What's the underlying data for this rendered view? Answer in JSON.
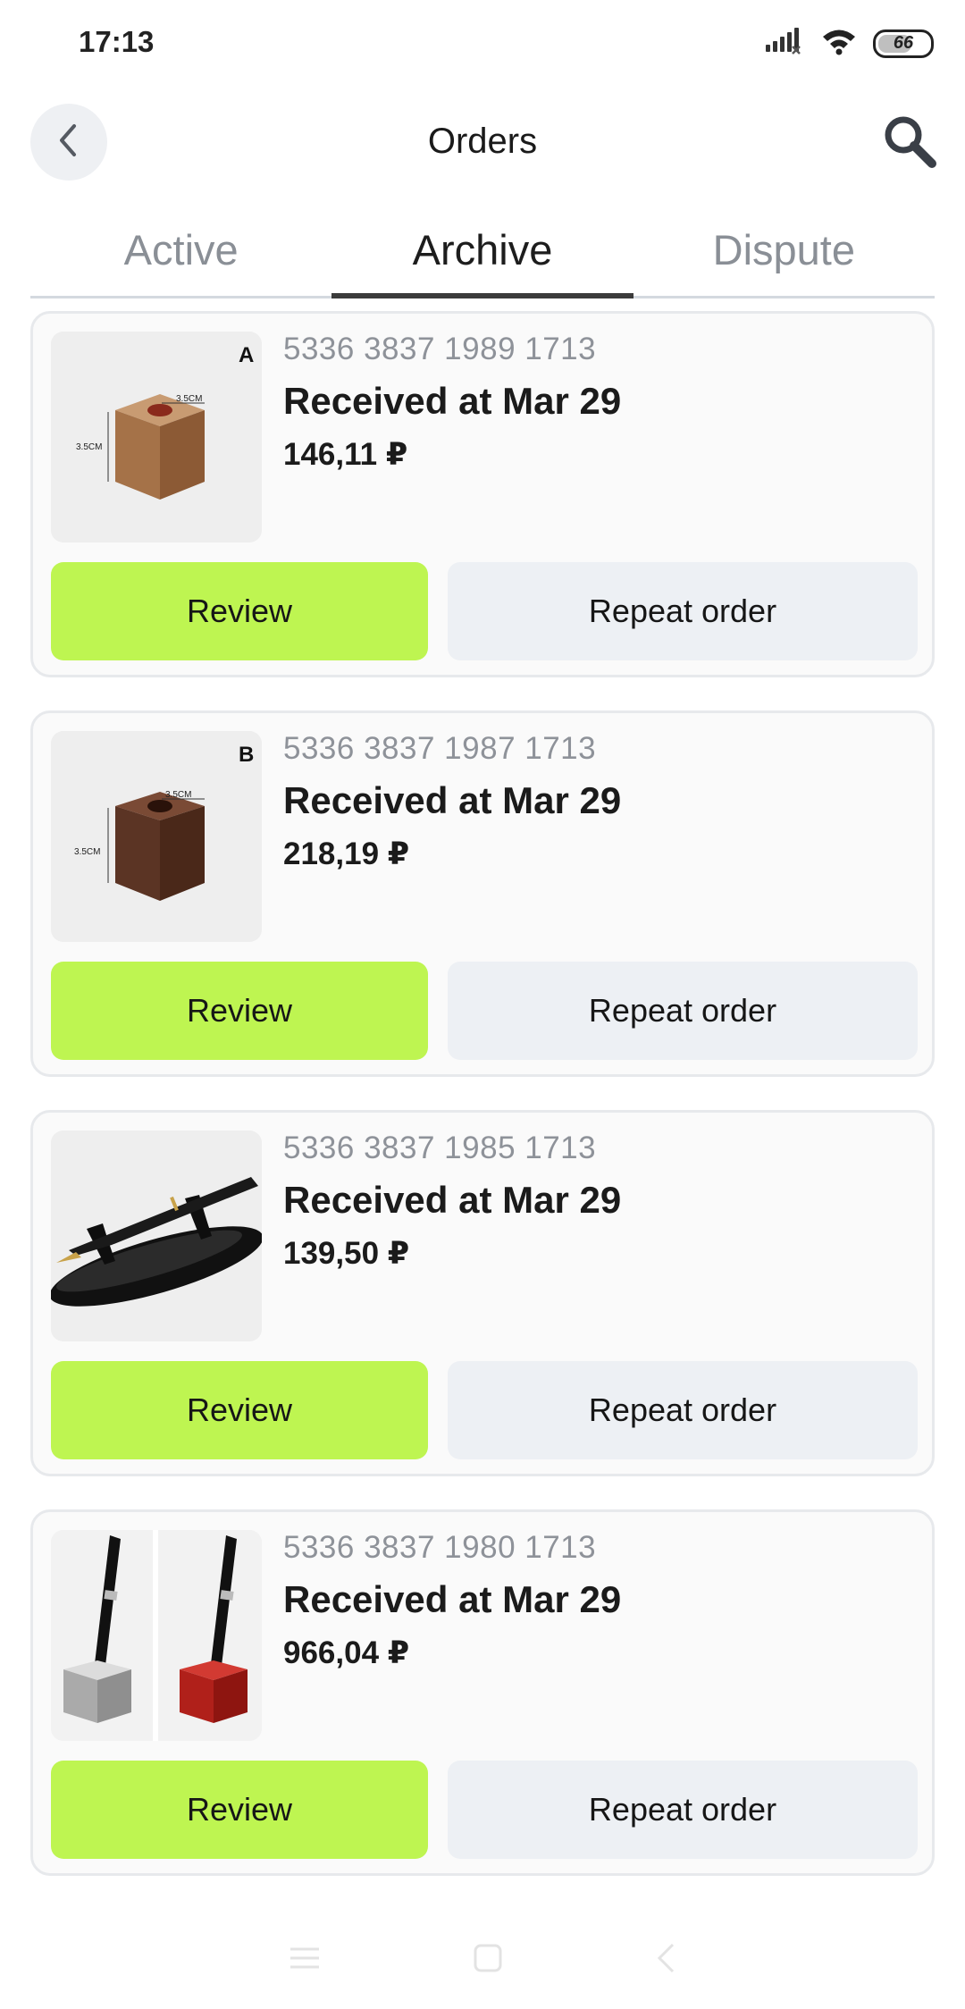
{
  "status_bar": {
    "time": "17:13",
    "battery": "66"
  },
  "header": {
    "title": "Orders"
  },
  "tabs": [
    {
      "label": "Active",
      "active": false
    },
    {
      "label": "Archive",
      "active": true
    },
    {
      "label": "Dispute",
      "active": false
    }
  ],
  "orders": [
    {
      "number": "5336 3837 1989 1713",
      "status": "Received at Mar 29",
      "price": "146,11 ₽",
      "image": "light-wood-cube-pen-holder",
      "variant_letter": "A",
      "dimension_top": "3.5CM",
      "dimension_side": "3.5CM",
      "review_label": "Review",
      "repeat_label": "Repeat order"
    },
    {
      "number": "5336 3837 1987 1713",
      "status": "Received at Mar 29",
      "price": "218,19 ₽",
      "image": "dark-wood-cube-pen-holder",
      "variant_letter": "B",
      "dimension_top": "3.5CM",
      "dimension_side": "3.5CM",
      "review_label": "Review",
      "repeat_label": "Repeat order"
    },
    {
      "number": "5336 3837 1985 1713",
      "status": "Received at Mar 29",
      "price": "139,50 ₽",
      "image": "fountain-pen-on-black-stand",
      "review_label": "Review",
      "repeat_label": "Repeat order"
    },
    {
      "number": "5336 3837 1980 1713",
      "status": "Received at Mar 29",
      "price": "966,04 ₽",
      "image": "pens-in-silver-and-red-holders",
      "review_label": "Review",
      "repeat_label": "Repeat order"
    }
  ],
  "colors": {
    "accent": "#bef551",
    "secondary_button": "#edf0f4",
    "muted_text": "#8e9299"
  }
}
